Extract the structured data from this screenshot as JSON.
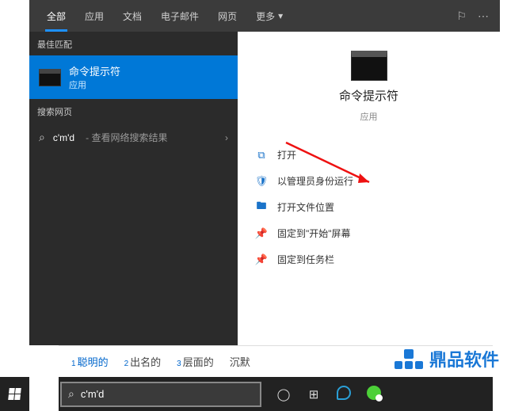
{
  "tabs": {
    "items": [
      "全部",
      "应用",
      "文档",
      "电子邮件",
      "网页"
    ],
    "more": "更多"
  },
  "left": {
    "bestMatchHeader": "最佳匹配",
    "result": {
      "title": "命令提示符",
      "sub": "应用"
    },
    "webHeader": "搜索网页",
    "web": {
      "query": "c'm'd",
      "hint": "- 查看网络搜索结果"
    }
  },
  "preview": {
    "title": "命令提示符",
    "sub": "应用"
  },
  "actions": {
    "open": "打开",
    "runAdmin": "以管理员身份运行",
    "openLoc": "打开文件位置",
    "pinStart": "固定到\"开始\"屏幕",
    "pinTaskbar": "固定到任务栏"
  },
  "suggestions": {
    "s1": "聪明的",
    "s2": "出名的",
    "s3": "层面的",
    "s4": "沉默"
  },
  "search": {
    "value": "c'm'd"
  },
  "watermark": "鼎品软件"
}
